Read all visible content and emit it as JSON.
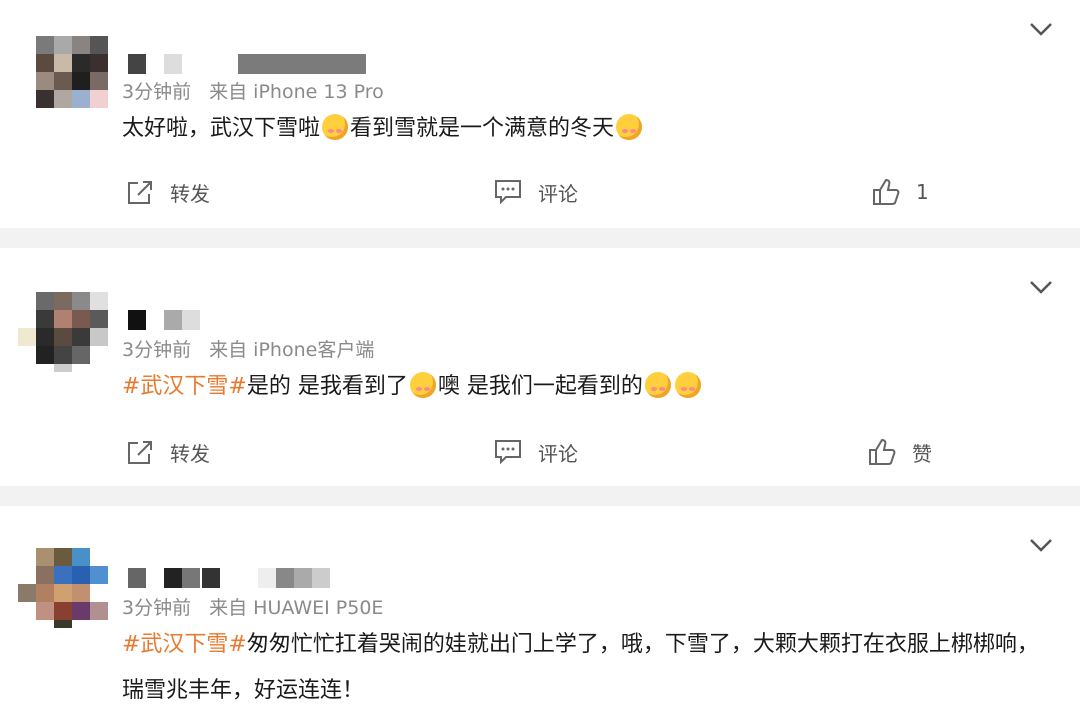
{
  "posts": [
    {
      "time": "3分钟前",
      "source": "来自 iPhone 13 Pro",
      "content_text": "太好啦，武汉下雪啦",
      "content_text2": "看到雪就是一个满意的冬天",
      "actions": {
        "repost": "转发",
        "comment": "评论",
        "like": "1"
      }
    },
    {
      "time": "3分钟前",
      "source": "来自 iPhone客户端",
      "hashtag": "#武汉下雪#",
      "content_text": "是的 是我看到了",
      "content_text2": "噢 是我们一起看到的",
      "actions": {
        "repost": "转发",
        "comment": "评论",
        "like": "赞"
      }
    },
    {
      "time": "3分钟前",
      "source": "来自 HUAWEI P50E",
      "hashtag": "#武汉下雪#",
      "content_text": "匆匆忙忙扛着哭闹的娃就出门上学了，哦，下雪了，大颗大颗打在衣服上梆梆响，瑞雪兆丰年，好运连连！"
    }
  ]
}
